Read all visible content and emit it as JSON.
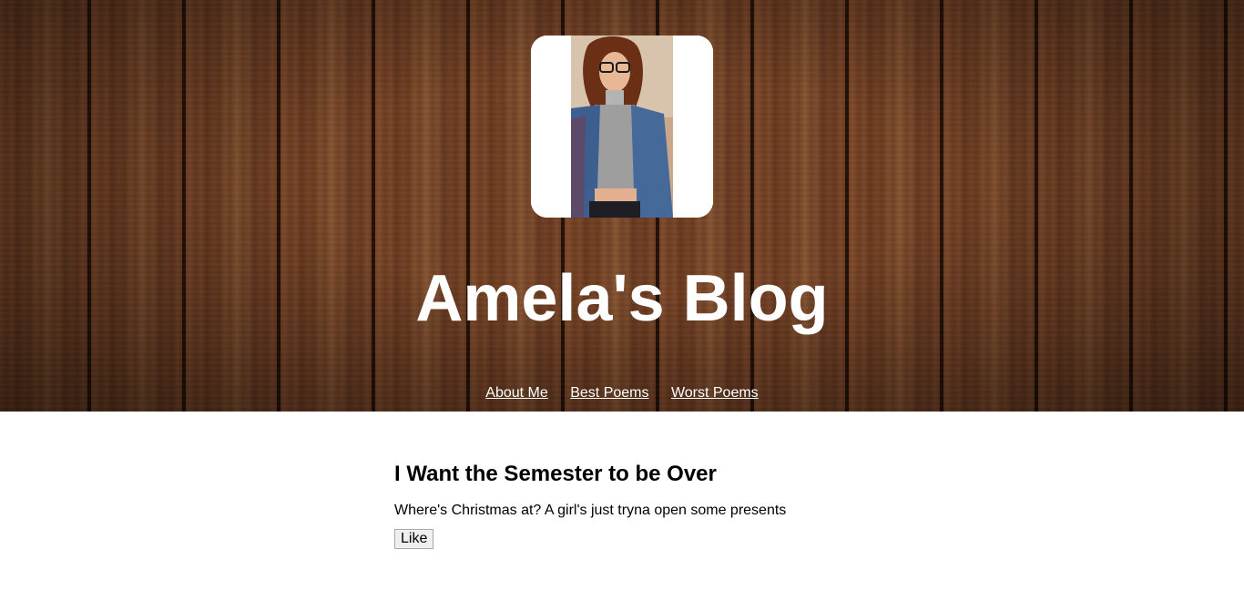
{
  "header": {
    "blog_title": "Amela's Blog",
    "avatar_alt": "profile photo"
  },
  "nav": {
    "items": [
      {
        "label": "About Me"
      },
      {
        "label": "Best Poems"
      },
      {
        "label": "Worst Poems"
      }
    ]
  },
  "post": {
    "title": "I Want the Semester to be Over",
    "body": "Where's Christmas at? A girl's just tryna open some presents",
    "like_label": "Like"
  },
  "colors": {
    "wood": "#6e3e22",
    "header_text": "#ffffff",
    "page_background": "#ffffff"
  }
}
